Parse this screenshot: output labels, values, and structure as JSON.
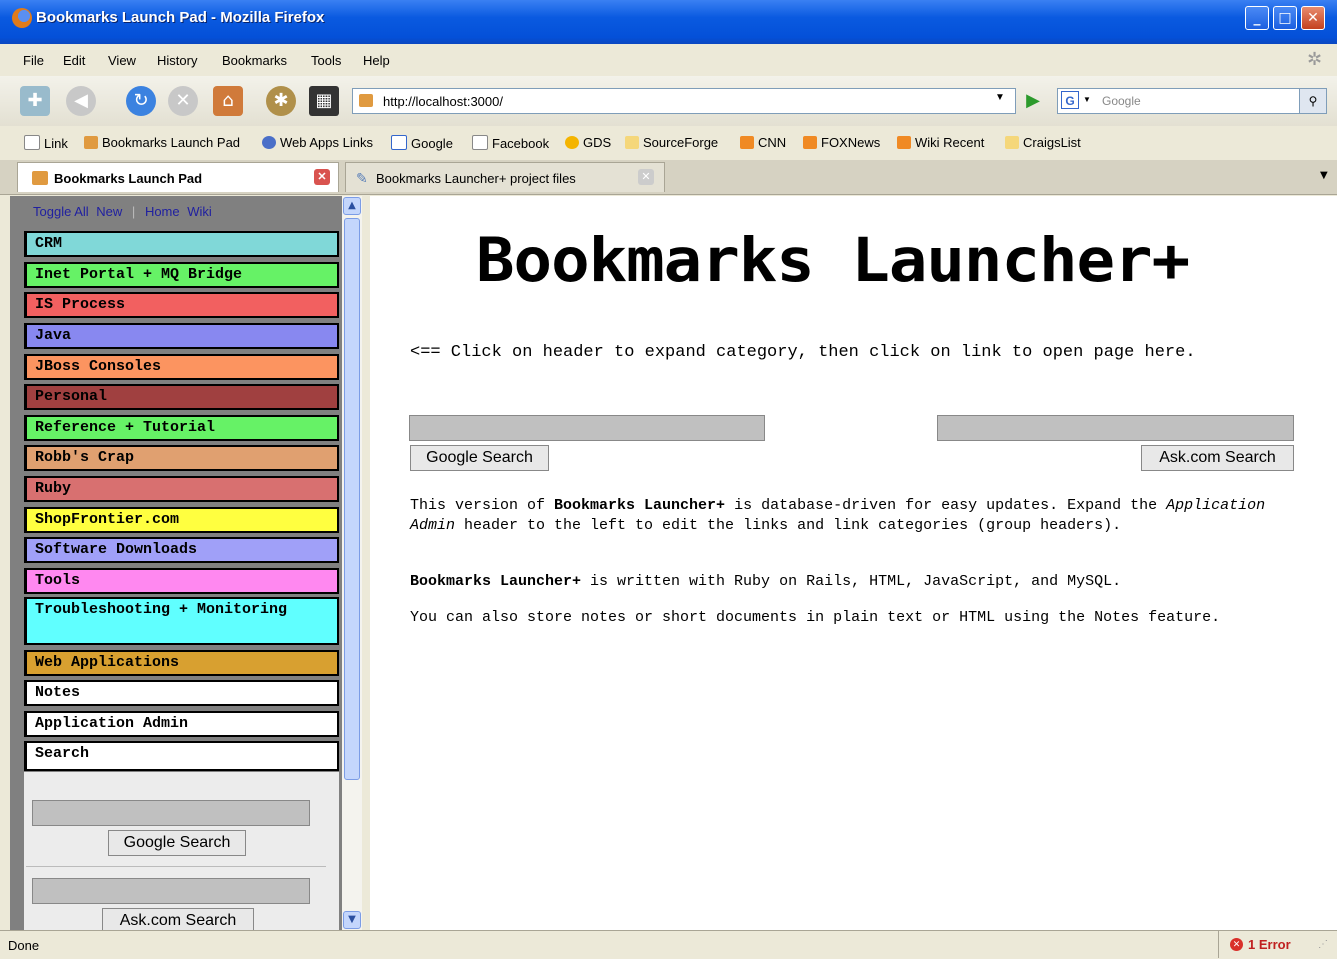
{
  "window": {
    "title": "Bookmarks Launch Pad - Mozilla Firefox"
  },
  "menu": [
    "File",
    "Edit",
    "View",
    "History",
    "Bookmarks",
    "Tools",
    "Help"
  ],
  "nav": {
    "url": "http://localhost:3000/",
    "search_placeholder": "Google"
  },
  "bookmarks": [
    "Link",
    "Bookmarks Launch Pad",
    "Web Apps Links",
    "Google",
    "Facebook",
    "GDS",
    "SourceForge",
    "CNN",
    "FOXNews",
    "Wiki Recent",
    "CraigsList"
  ],
  "tabs": [
    "Bookmarks Launch Pad",
    "Bookmarks Launcher+ project files"
  ],
  "sidebar": {
    "links": [
      "Toggle All",
      "New",
      "|",
      "Home",
      "Wiki"
    ],
    "categories": [
      {
        "label": "CRM",
        "color": "#80d8d8"
      },
      {
        "label": "Inet Portal + MQ Bridge",
        "color": "#66f266"
      },
      {
        "label": "IS Process",
        "color": "#f26060"
      },
      {
        "label": "Java",
        "color": "#8888f0"
      },
      {
        "label": "JBoss Consoles",
        "color": "#fc9460"
      },
      {
        "label": "Personal",
        "color": "#a04040"
      },
      {
        "label": "Reference + Tutorial",
        "color": "#66f266"
      },
      {
        "label": "Robb's Crap",
        "color": "#e0a070"
      },
      {
        "label": "Ruby",
        "color": "#d87070"
      },
      {
        "label": "ShopFrontier.com",
        "color": "#ffff40"
      },
      {
        "label": "Software Downloads",
        "color": "#a0a0f8"
      },
      {
        "label": "Tools",
        "color": "#ff88f0"
      },
      {
        "label": "Troubleshooting + Monitoring",
        "color": "#60ffff"
      },
      {
        "label": "Web Applications",
        "color": "#d8a030"
      },
      {
        "label": "Notes",
        "color": "#ffffff"
      },
      {
        "label": "Application Admin",
        "color": "#ffffff"
      },
      {
        "label": "Search",
        "color": "#ffffff"
      }
    ],
    "google_button": "Google Search",
    "ask_button": "Ask.com Search"
  },
  "main": {
    "logo_text": "Bookmarks Launcher+",
    "instructions": "<== Click on header to expand category, then click on link to open page here.",
    "google_button": "Google Search",
    "ask_button": "Ask.com Search",
    "p1": {
      "a": "This version of ",
      "b": "Bookmarks Launcher+",
      "c": " is database-driven for easy updates. Expand the ",
      "d": "Application Admin",
      "e": " header to the left to edit the links and link categories (group headers)."
    },
    "p2": {
      "b": "Bookmarks Launcher+",
      "c": " is written with Ruby on Rails, HTML, JavaScript, and MySQL."
    },
    "p3": "You can also store notes or short documents in plain text or HTML using the Notes feature."
  },
  "status": {
    "text": "Done",
    "error": "1 Error"
  }
}
